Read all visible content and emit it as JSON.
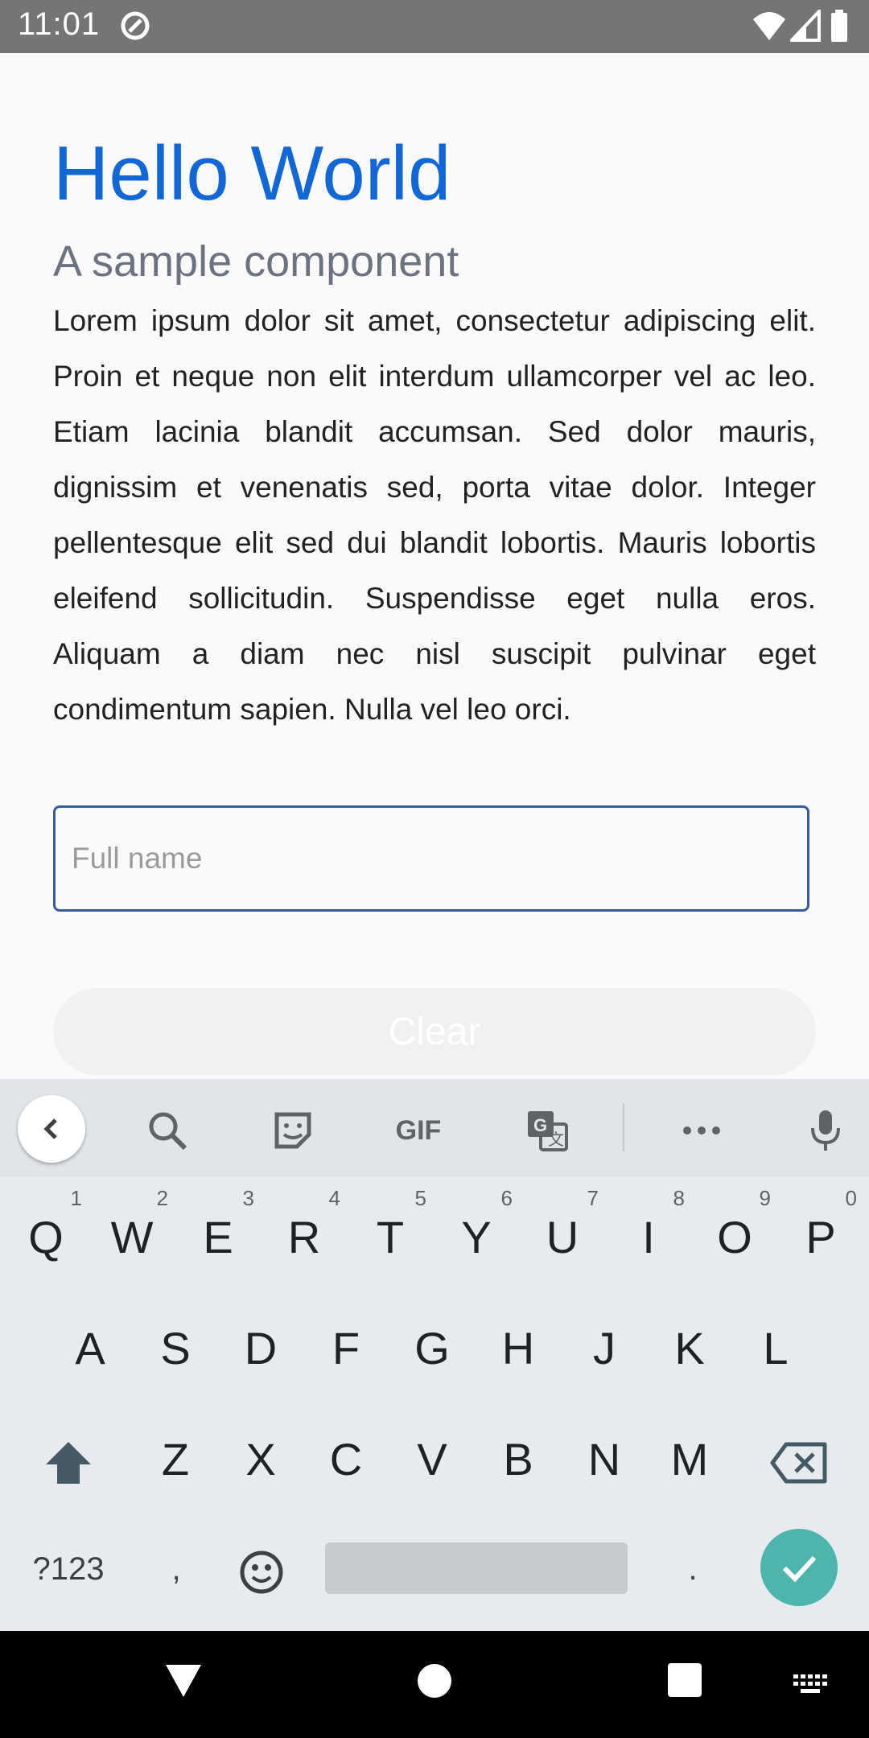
{
  "status_bar": {
    "time": "11:01",
    "icons": [
      "at-sign-icon",
      "wifi-icon",
      "signal-icon",
      "battery-icon"
    ]
  },
  "content": {
    "title": "Hello World",
    "subtitle": "A sample component",
    "body": "Lorem ipsum dolor sit amet, consectetur adipiscing elit. Proin et neque non elit interdum ullamcorper vel ac leo. Etiam lacinia blandit accumsan. Sed dolor mauris, dignissim et venenatis sed, porta vitae dolor. Integer pellentesque elit sed dui blandit lobortis. Mauris lobortis eleifend sollicitudin. Suspendisse eget nulla eros. Aliquam a diam nec nisl suscipit pulvinar eget condimentum sapien. Nulla vel leo orci.",
    "name_field": {
      "value": "",
      "placeholder": "Full name"
    },
    "clear_label": "Clear"
  },
  "keyboard": {
    "toolbar": [
      "collapse-icon",
      "search-icon",
      "sticker-icon",
      "GIF",
      "translate-icon",
      "more-icon",
      "mic-icon"
    ],
    "gif_label": "GIF",
    "row1": [
      {
        "k": "Q",
        "h": "1"
      },
      {
        "k": "W",
        "h": "2"
      },
      {
        "k": "E",
        "h": "3"
      },
      {
        "k": "R",
        "h": "4"
      },
      {
        "k": "T",
        "h": "5"
      },
      {
        "k": "Y",
        "h": "6"
      },
      {
        "k": "U",
        "h": "7"
      },
      {
        "k": "I",
        "h": "8"
      },
      {
        "k": "O",
        "h": "9"
      },
      {
        "k": "P",
        "h": "0"
      }
    ],
    "row2": [
      "A",
      "S",
      "D",
      "F",
      "G",
      "H",
      "J",
      "K",
      "L"
    ],
    "row3": [
      "Z",
      "X",
      "C",
      "V",
      "B",
      "N",
      "M"
    ],
    "symbols_label": "?123",
    "comma": ",",
    "period": "."
  },
  "colors": {
    "title": "#1167d6",
    "accent": "#4db6ac",
    "status_bar": "#757575"
  }
}
